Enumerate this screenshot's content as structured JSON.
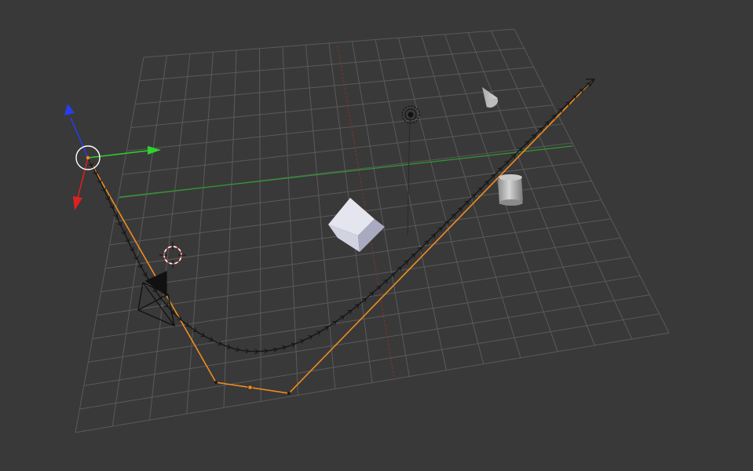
{
  "viewport": {
    "background_color": "#393939",
    "grid_color": "#5a5a5a",
    "x_axis_color": "#b23a3a",
    "y_axis_color": "#3fa33f",
    "gizmo_colors": {
      "x": "#e02020",
      "y": "#2fd12f",
      "z": "#2a3df0"
    },
    "curve_color": "#f08c1e",
    "path_arrow_color": "#1a1a1a"
  },
  "objects": [
    {
      "name": "cube",
      "icon": "cube-icon"
    },
    {
      "name": "cone",
      "icon": "cone-icon"
    },
    {
      "name": "cylinder",
      "icon": "cylinder-icon"
    },
    {
      "name": "lamp",
      "icon": "lamp-icon"
    },
    {
      "name": "camera",
      "icon": "camera-icon"
    },
    {
      "name": "3d-cursor",
      "icon": "crosshair-icon"
    },
    {
      "name": "bezier-path",
      "icon": "curve-icon"
    },
    {
      "name": "transform-gizmo",
      "icon": "axis-gizmo-icon"
    }
  ]
}
